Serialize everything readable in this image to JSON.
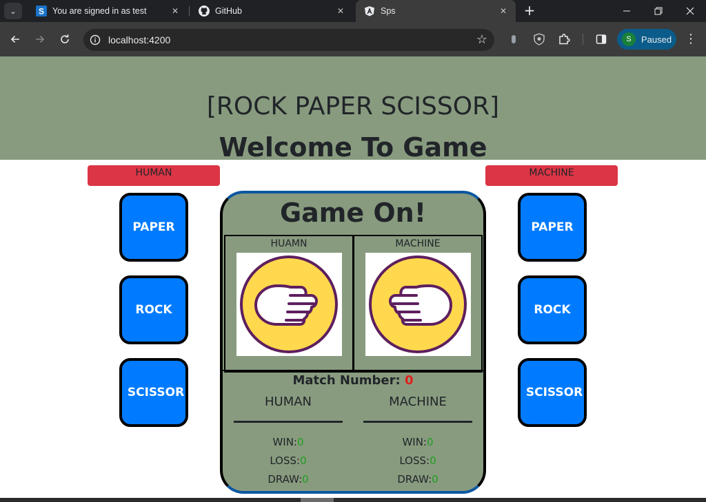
{
  "browser": {
    "tabs": [
      {
        "title": "You are signed in as test",
        "active": false
      },
      {
        "title": "GitHub",
        "active": false
      },
      {
        "title": "Sps",
        "active": true
      }
    ],
    "url": "localhost:4200",
    "profile_label": "Paused",
    "profile_initial": "S"
  },
  "header": {
    "title": "[ROCK PAPER SCISSOR]",
    "subtitle": "Welcome To Game"
  },
  "human_panel": {
    "label": "HUMAN",
    "choices": [
      "PAPER",
      "ROCK",
      "SCISSOR"
    ]
  },
  "machine_panel": {
    "label": "MACHINE",
    "choices": [
      "PAPER",
      "ROCK",
      "SCISSOR"
    ]
  },
  "board": {
    "title": "Game On!",
    "human_label": "HUAMN",
    "machine_label": "MACHINE",
    "human_hand_icon": "paper-hand-icon",
    "machine_hand_icon": "paper-hand-icon",
    "match_label": "Match Number:",
    "match_number": "0",
    "human_col": "HUMAN",
    "machine_col": "MACHINE",
    "human_stats": {
      "win_label": "WIN:",
      "win": "0",
      "loss_label": "LOSS:",
      "loss": "0",
      "draw_label": "DRAW:",
      "draw": "0"
    },
    "machine_stats": {
      "win_label": "WIN:",
      "win": "0",
      "loss_label": "LOSS:",
      "loss": "0",
      "draw_label": "DRAW:",
      "draw": "0"
    }
  },
  "colors": {
    "hero_bg": "#889b7f",
    "label_red": "#dc3545",
    "button_blue": "#007bff",
    "stat_green": "#1e9e1e",
    "match_red": "#e0201b"
  }
}
